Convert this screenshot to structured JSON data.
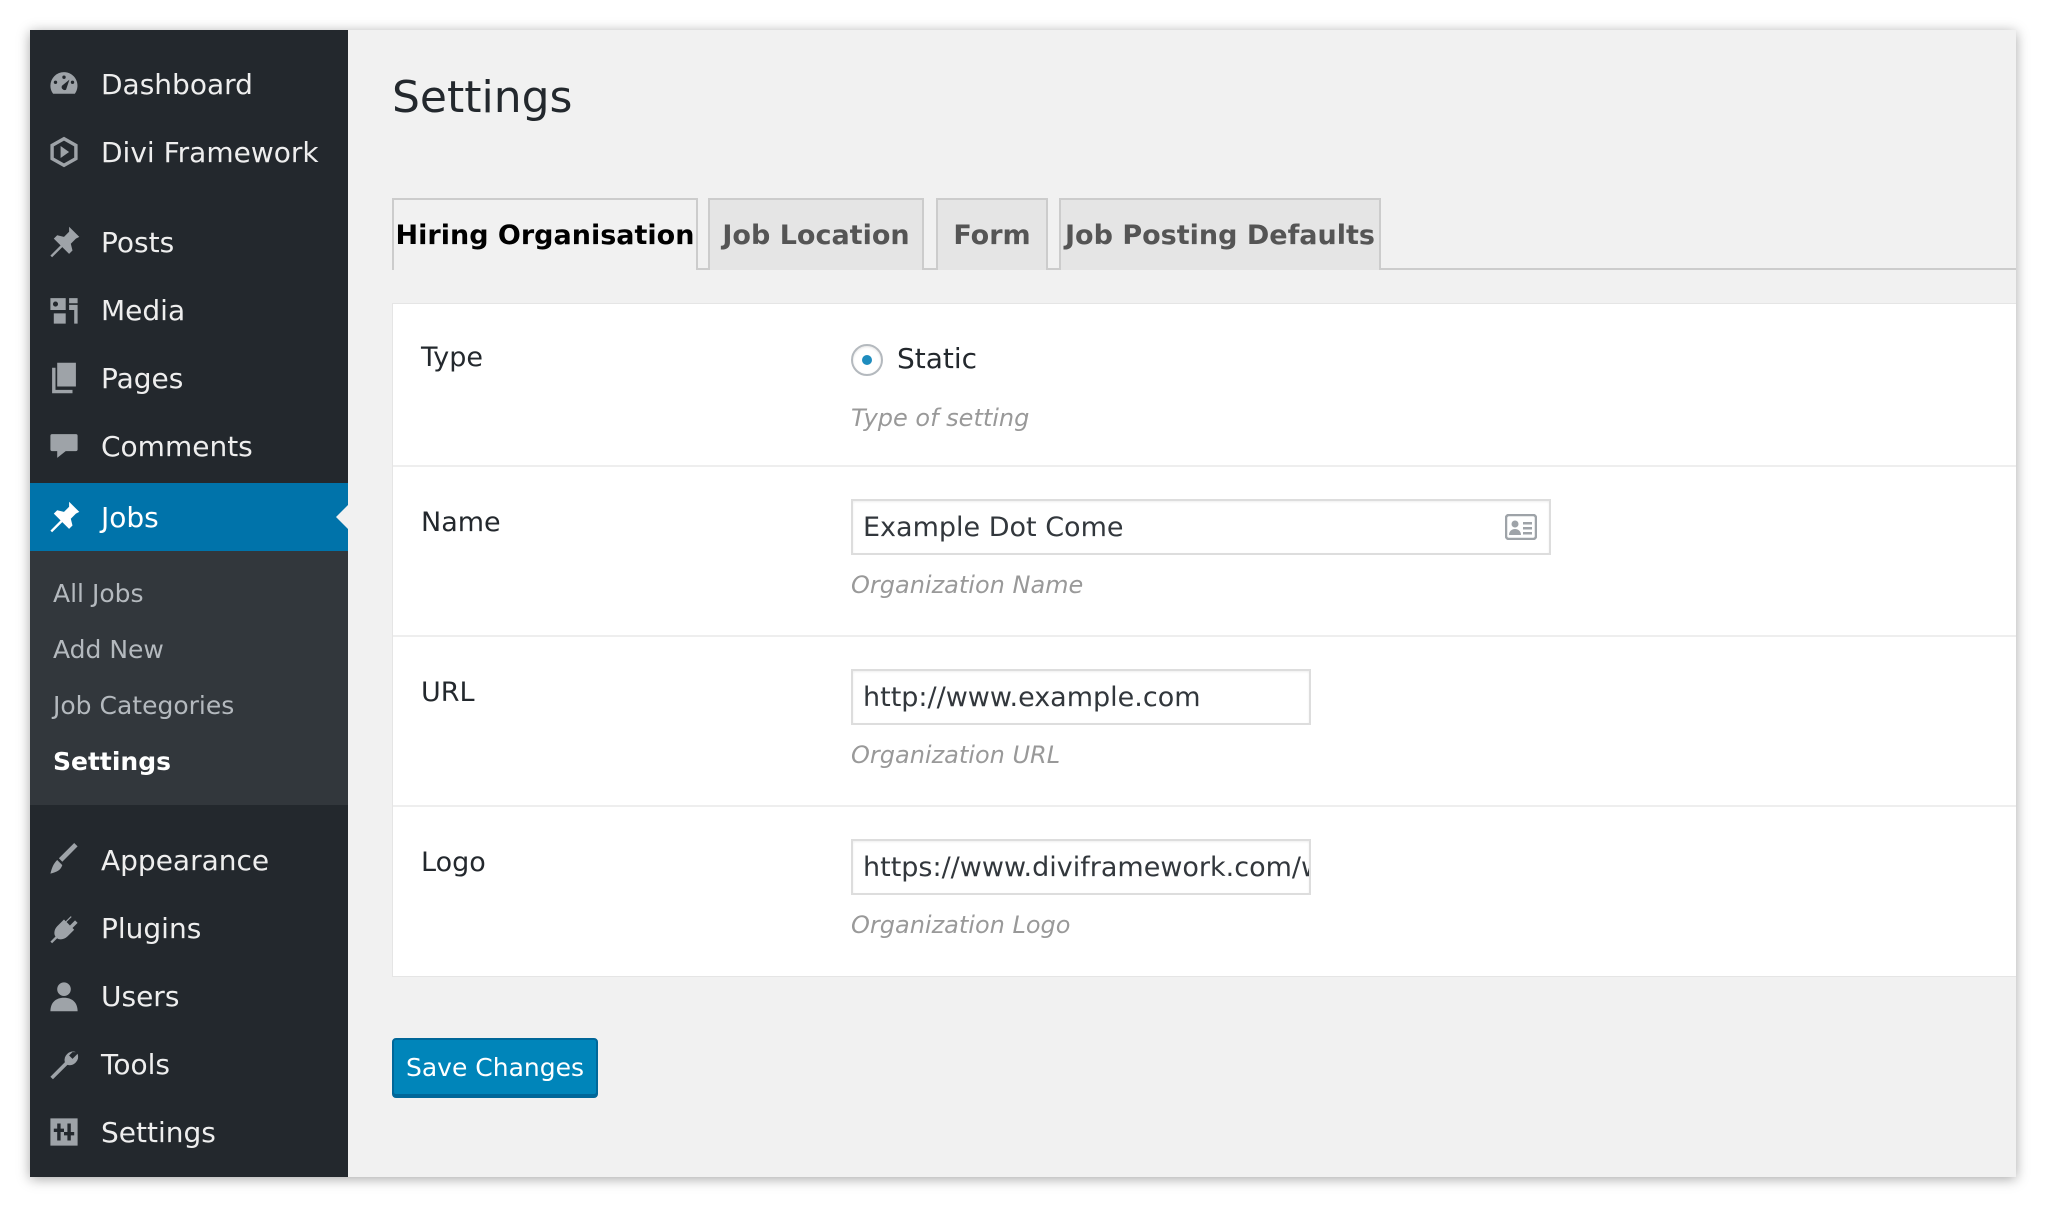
{
  "sidebar": {
    "items": [
      {
        "label": "Dashboard",
        "icon": "dashboard-icon"
      },
      {
        "label": "Divi Framework",
        "icon": "divi-icon"
      },
      {
        "label": "Posts",
        "icon": "pin-icon"
      },
      {
        "label": "Media",
        "icon": "media-icon"
      },
      {
        "label": "Pages",
        "icon": "pages-icon"
      },
      {
        "label": "Comments",
        "icon": "comment-icon"
      },
      {
        "label": "Jobs",
        "icon": "pin-icon"
      },
      {
        "label": "Appearance",
        "icon": "brush-icon"
      },
      {
        "label": "Plugins",
        "icon": "plug-icon"
      },
      {
        "label": "Users",
        "icon": "user-icon"
      },
      {
        "label": "Tools",
        "icon": "wrench-icon"
      },
      {
        "label": "Settings",
        "icon": "sliders-icon"
      }
    ],
    "active": "Jobs",
    "submenu": [
      "All Jobs",
      "Add New",
      "Job Categories",
      "Settings"
    ],
    "submenu_current": "Settings"
  },
  "page": {
    "title": "Settings"
  },
  "tabs": [
    {
      "label": "Hiring Organisation",
      "active": true
    },
    {
      "label": "Job Location",
      "active": false
    },
    {
      "label": "Form",
      "active": false
    },
    {
      "label": "Job Posting Defaults",
      "active": false
    }
  ],
  "form": {
    "type": {
      "label": "Type",
      "option": "Static",
      "description": "Type of setting"
    },
    "name": {
      "label": "Name",
      "value": "Example Dot Come",
      "description": "Organization Name"
    },
    "url": {
      "label": "URL",
      "value": "http://www.example.com",
      "description": "Organization URL"
    },
    "logo": {
      "label": "Logo",
      "value": "https://www.diviframework.com/w",
      "description": "Organization Logo"
    }
  },
  "save_label": "Save Changes",
  "colors": {
    "sidebar": "#23282d",
    "accent": "#0073aa",
    "button": "#0085ba",
    "background": "#f1f1f1"
  }
}
